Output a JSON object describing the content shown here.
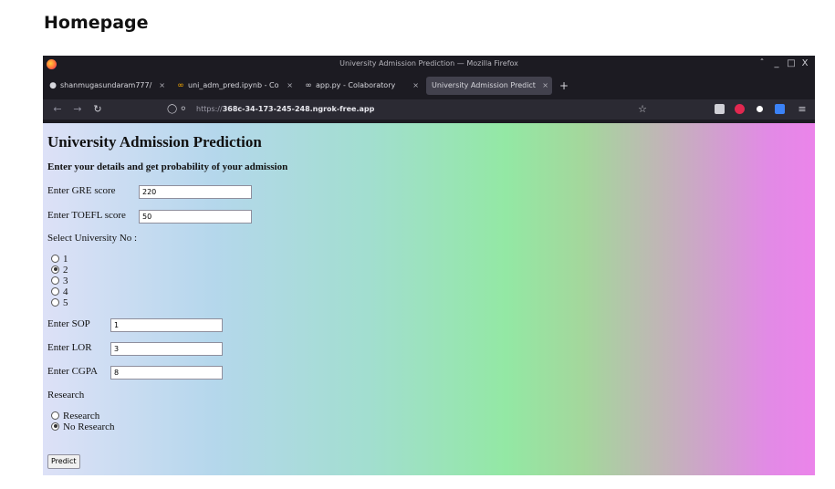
{
  "page_heading": "Homepage",
  "window": {
    "title": "University Admission Prediction — Mozilla Firefox",
    "controls": [
      "ˆ",
      "_",
      "□",
      "X"
    ]
  },
  "tabs": [
    {
      "icon": "github-icon",
      "glyph": "●",
      "label": "shanmugasundaram777/"
    },
    {
      "icon": "colab-icon",
      "glyph": "∞",
      "label": "uni_adm_pred.ipynb - Co"
    },
    {
      "icon": "colab-icon",
      "glyph": "∞",
      "label": "app.py - Colaboratory"
    },
    {
      "icon": "none",
      "glyph": "",
      "label": "University Admission Predict",
      "active": true
    }
  ],
  "tab_close": "×",
  "new_tab": "+",
  "nav": {
    "back": "←",
    "forward": "→",
    "reload": "↻",
    "url_prefix": "https://",
    "url_host": "368c-34-173-245-248.ngrok-free.app"
  },
  "form": {
    "title": "University Admission Prediction",
    "subtitle": "Enter your details and get probability of your admission",
    "gre_label": "Enter GRE score",
    "gre_value": "220",
    "toefl_label": "Enter TOEFL score",
    "toefl_value": "50",
    "university_label": "Select University No :",
    "university_options": [
      "1",
      "2",
      "3",
      "4",
      "5"
    ],
    "university_selected": "2",
    "sop_label": "Enter SOP",
    "sop_value": "1",
    "lor_label": "Enter LOR",
    "lor_value": "3",
    "cgpa_label": "Enter CGPA",
    "cgpa_value": "8",
    "research_label": "Research",
    "research_options": [
      "Research",
      "No Research"
    ],
    "research_selected": "No Research",
    "predict_label": "Predict"
  },
  "colors": {
    "browser_chrome": "#1c1b22",
    "toolbar": "#2b2a33",
    "gradient": [
      "#dde1f7",
      "#b5d7ec",
      "#93e8a4",
      "#eb84ea"
    ]
  }
}
